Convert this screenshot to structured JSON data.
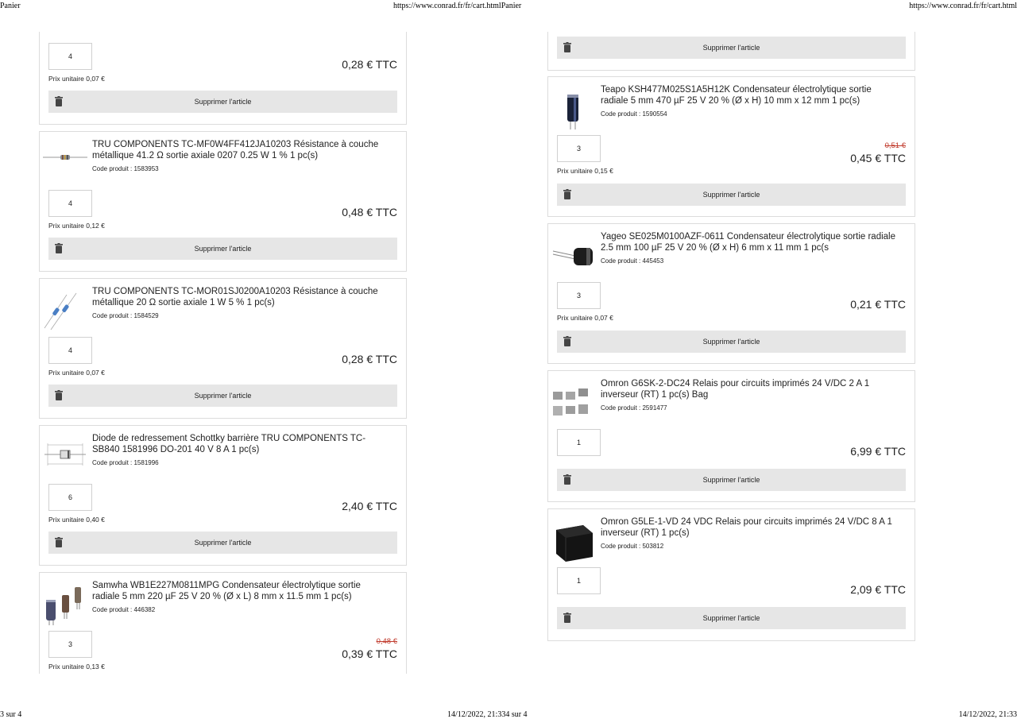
{
  "print_header": {
    "left": "Panier",
    "center": "https://www.conrad.fr/fr/cart.htmlPanier",
    "right": "https://www.conrad.fr/fr/cart.html"
  },
  "print_footer": {
    "left": "3 sur 4",
    "center": "14/12/2022, 21:334 sur 4",
    "right": "14/12/2022, 21:33"
  },
  "labels": {
    "delete": "Supprimer l'article",
    "unit_prefix": "Prix unitaire"
  },
  "left_items": [
    {
      "qty": "4",
      "unit": "Prix unitaire 0,07 €",
      "price": "0,28 € TTC"
    },
    {
      "name": "TRU COMPONENTS TC-MF0W4FF412JA10203 Résistance à couche métallique 41.2 Ω sortie axiale 0207 0.25 W 1 % 1 pc(s)",
      "code": "Code produit : 1583953",
      "image": "axial-resistor-image",
      "qty": "4",
      "unit": "Prix unitaire 0,12 €",
      "price": "0,48 € TTC"
    },
    {
      "name": "TRU COMPONENTS TC-MOR01SJ0200A10203 Résistance à couche métallique 20 Ω sortie axiale 1 W 5 % 1 pc(s)",
      "code": "Code produit : 1584529",
      "image": "blue-resistor-image",
      "qty": "4",
      "unit": "Prix unitaire 0,07 €",
      "price": "0,28 € TTC"
    },
    {
      "name": "Diode de redressement Schottky barrière TRU COMPONENTS TC-SB840 1581996 DO-201 40 V 8 A 1 pc(s)",
      "code": "Code produit : 1581996",
      "image": "diode-drawing-image",
      "qty": "6",
      "unit": "Prix unitaire 0,40 €",
      "price": "2,40 € TTC"
    },
    {
      "name": "Samwha WB1E227M0811MPG Condensateur électrolytique sortie radiale 5 mm 220 µF 25 V 20 % (Ø x L) 8 mm x 11.5 mm 1 pc(s)",
      "code": "Code produit : 446382",
      "image": "capacitors-image",
      "qty": "3",
      "unit": "Prix unitaire 0,13 €",
      "old_price": "0,48 €",
      "price": "0,39 € TTC"
    }
  ],
  "right_items": [
    {
      "note": "tail of previous item"
    },
    {
      "name": "Teapo KSH477M025S1A5H12K Condensateur électrolytique sortie radiale 5 mm 470 µF 25 V 20 % (Ø x H) 10 mm x 12 mm 1 pc(s)",
      "code": "Code produit : 1590554",
      "image": "teapo-capacitor-image",
      "qty": "3",
      "unit": "Prix unitaire 0,15 €",
      "old_price": "0,51 €",
      "price": "0,45 € TTC"
    },
    {
      "name": "Yageo SE025M0100AZF-0611 Condensateur électrolytique sortie radiale 2.5 mm 100 µF 25 V 20 % (Ø x H) 6 mm x 11 mm 1 pc(s",
      "code": "Code produit : 445453",
      "image": "yageo-capacitor-image",
      "qty": "3",
      "unit": "Prix unitaire 0,07 €",
      "price": "0,21 € TTC"
    },
    {
      "name": "Omron G6SK-2-DC24 Relais pour circuits imprimés 24 V/DC 2 A 1 inverseur (RT) 1 pc(s) Bag",
      "code": "Code produit : 2591477",
      "image": "omron-relays-image",
      "qty": "1",
      "price": "6,99 € TTC"
    },
    {
      "name": "Omron G5LE-1-VD 24 VDC Relais pour circuits imprimés 24 V/DC 8 A 1 inverseur (RT) 1 pc(s)",
      "code": "Code produit : 503812",
      "image": "omron-black-relay-image",
      "qty": "1",
      "price": "2,09 € TTC"
    }
  ]
}
